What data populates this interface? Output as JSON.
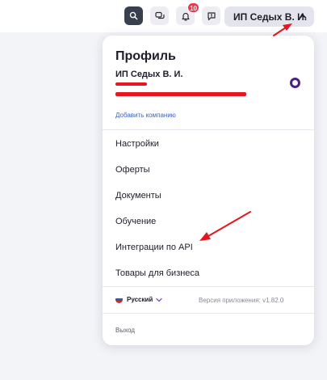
{
  "header": {
    "notification_count": "10",
    "profile_label": "ИП Седых В. И.",
    "icons": [
      "search-icon",
      "chat-icon",
      "bell-icon",
      "feedback-icon",
      "chevron-up-icon"
    ]
  },
  "dropdown": {
    "title": "Профиль",
    "company_name": "ИП Седых В. И.",
    "add_company": "Добавить компанию",
    "menu": [
      {
        "label": "Настройки"
      },
      {
        "label": "Оферты"
      },
      {
        "label": "Документы"
      },
      {
        "label": "Обучение"
      },
      {
        "label": "Интеграции по API"
      },
      {
        "label": "Товары для бизнеса"
      }
    ],
    "language": "Русский",
    "version": "Версия приложения: v1.82.0",
    "logout": "Выход"
  },
  "colors": {
    "annotation_red": "#e8141e",
    "badge_red": "#f0344b",
    "link_blue": "#3a63c8",
    "radio_purple": "#4a1f8f"
  }
}
